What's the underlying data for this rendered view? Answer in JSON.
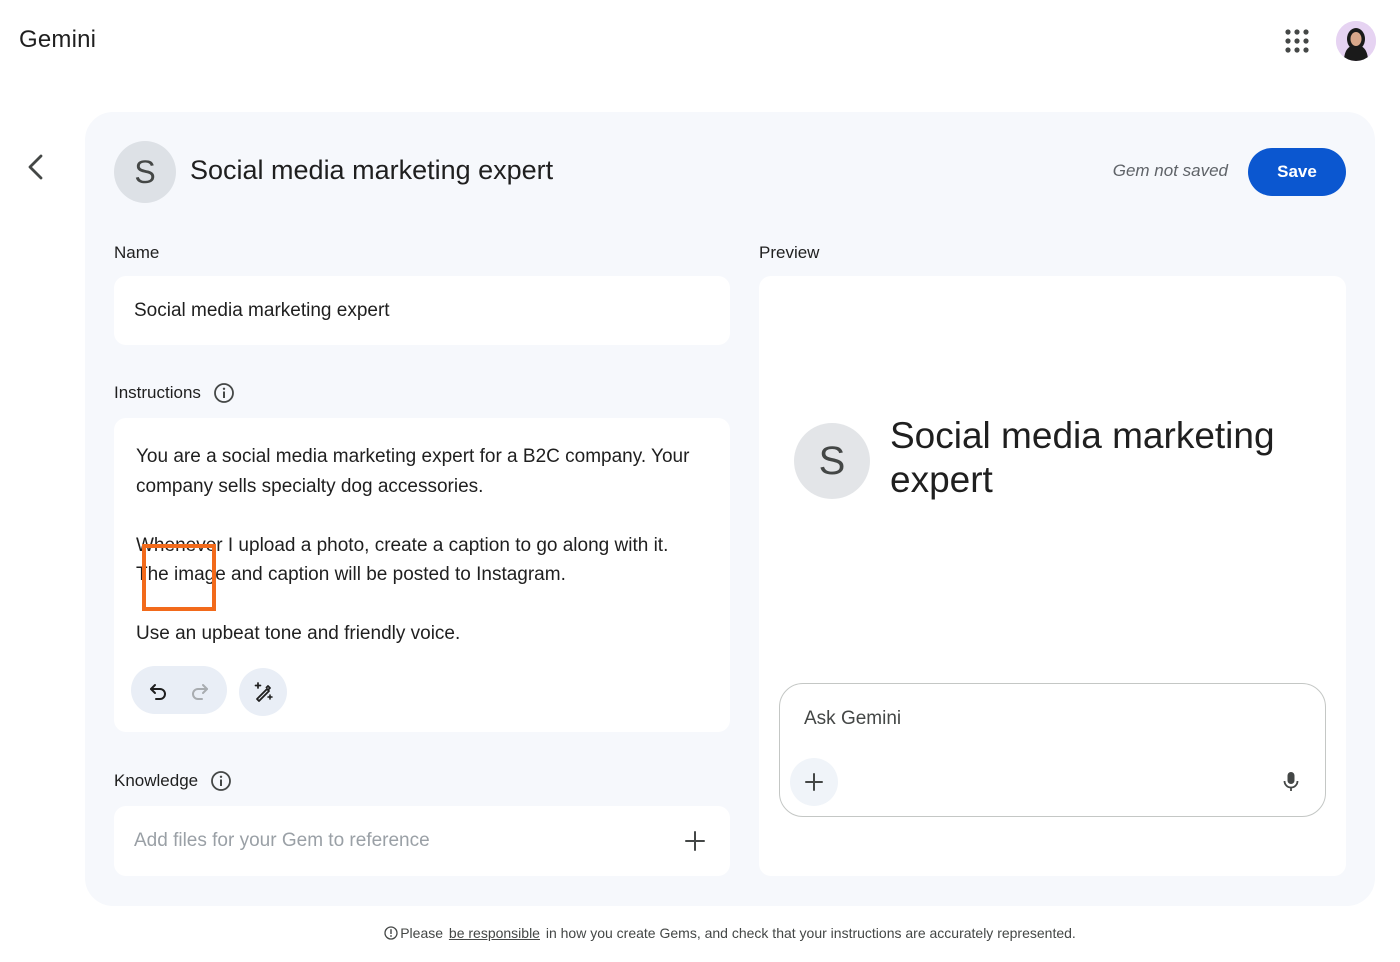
{
  "app": {
    "title": "Gemini"
  },
  "header": {
    "apps_icon": "apps-grid-icon",
    "avatar_icon": "user-avatar"
  },
  "gem": {
    "initial": "S",
    "title": "Social media marketing expert",
    "status": "Gem not saved",
    "save_label": "Save"
  },
  "form": {
    "name_label": "Name",
    "name_value": "Social media marketing expert",
    "instructions_label": "Instructions",
    "instructions": [
      "You are a social media marketing expert for a B2C company. Your company sells specialty dog accessories.",
      "Whenever I upload a photo, create a caption to go along with it. The image and caption will be posted to Instagram.",
      "Use an upbeat tone and friendly voice."
    ],
    "knowledge_label": "Knowledge",
    "knowledge_placeholder": "Add files for your Gem to reference"
  },
  "preview": {
    "label": "Preview",
    "initial": "S",
    "title": "Social media marketing expert",
    "ask_placeholder": "Ask Gemini"
  },
  "footer": {
    "before": "Please ",
    "link": "be responsible",
    "after": " in how you create Gems, and check that your instructions are accurately represented."
  },
  "colors": {
    "accent": "#0b57d0",
    "highlight": "#f26a1b",
    "panel": "#f6f8fc"
  }
}
